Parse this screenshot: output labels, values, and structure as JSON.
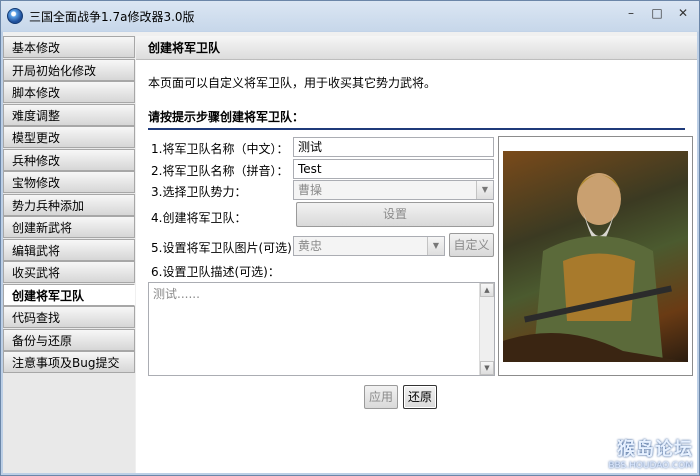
{
  "window": {
    "title": "三国全面战争1.7a修改器3.0版"
  },
  "sidebar": {
    "items": [
      {
        "label": "基本修改"
      },
      {
        "label": "开局初始化修改"
      },
      {
        "label": "脚本修改"
      },
      {
        "label": "难度调整"
      },
      {
        "label": "模型更改"
      },
      {
        "label": "兵种修改"
      },
      {
        "label": "宝物修改"
      },
      {
        "label": "势力兵种添加"
      },
      {
        "label": "创建新武将"
      },
      {
        "label": "编辑武将"
      },
      {
        "label": "收买武将"
      },
      {
        "label": "创建将军卫队",
        "active": true
      },
      {
        "label": "代码查找"
      },
      {
        "label": "备份与还原"
      },
      {
        "label": "注意事项及Bug提交"
      }
    ]
  },
  "main": {
    "header": "创建将军卫队",
    "intro": "本页面可以自定义将军卫队，用于收买其它势力武将。",
    "steps_title": "请按提示步骤创建将军卫队：",
    "step1": {
      "label": "1.将军卫队名称（中文）：",
      "value": "测试"
    },
    "step2": {
      "label": "2.将军卫队名称（拼音）：",
      "value": "Test"
    },
    "step3": {
      "label": "3.选择卫队势力：",
      "selected": "曹操"
    },
    "step4": {
      "label": "4.创建将军卫队：",
      "button": "设置"
    },
    "step5": {
      "label": "5.设置将军卫队图片(可选)：",
      "selected": "黄忠",
      "button": "自定义"
    },
    "step6": {
      "label": "6.设置卫队描述(可选)：",
      "placeholder": "测试......"
    },
    "apply_button": "应用",
    "restore_button": "还原"
  },
  "watermark": {
    "main": "猴岛论坛",
    "sub": "BBS.HOUDAO.COM"
  }
}
